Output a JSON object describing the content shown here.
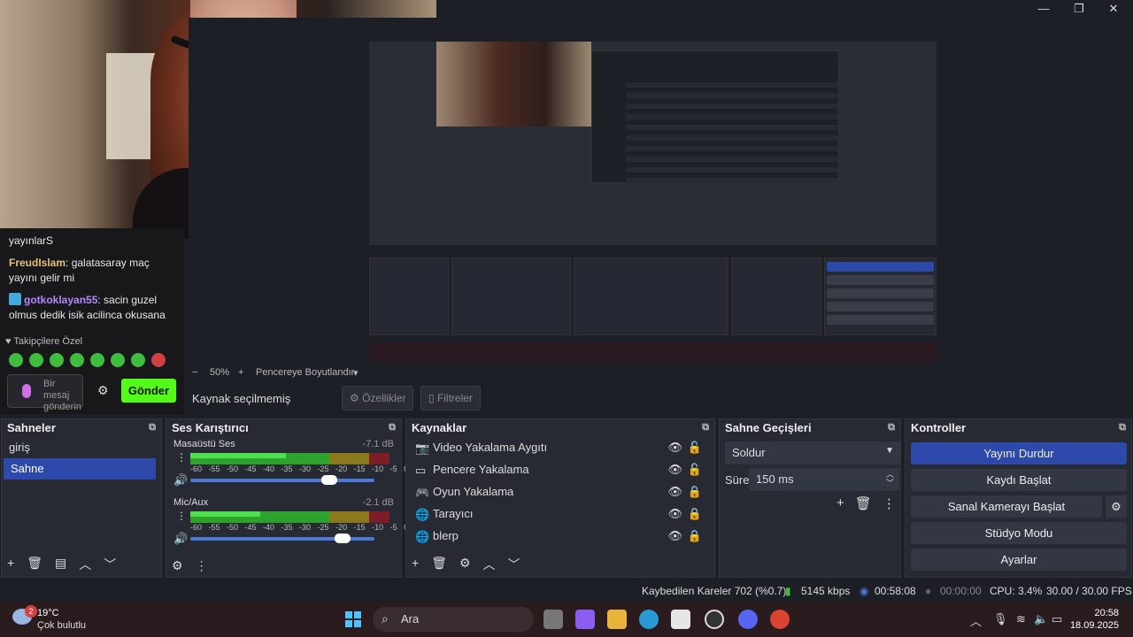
{
  "window": {
    "minimize": "—",
    "maximize": "❐",
    "close": "✕"
  },
  "chat": {
    "msg0_tail": "yayınlarS",
    "msg1_user": "FreudIslam",
    "msg1_text": ": galatasaray maç yayını gelir mi",
    "msg2_user": "gotkoklayan55",
    "msg2_text": ": sacin guzel olmus dedik isik acilinca okusana",
    "follow_label": "Takipçilere Özel",
    "input_placeholder": "Bir mesaj gönderin",
    "send_label": "Gönder"
  },
  "zoom": {
    "minus": "−",
    "level": "50%",
    "plus": "+",
    "fit": "Pencereye Boyutlandır"
  },
  "source_toolbar": {
    "no_source": "Kaynak seçilmemiş",
    "properties": "Özellikler",
    "filters": "Filtreler"
  },
  "scenes": {
    "title": "Sahneler",
    "items": [
      "giriş",
      "Sahne"
    ]
  },
  "mixer": {
    "title": "Ses Karıştırıcı",
    "tracks": [
      {
        "name": "Masaüstü Ses",
        "db": "-7.1 dB",
        "level": 0.48,
        "volume": 0.78
      },
      {
        "name": "Mic/Aux",
        "db": "-2.1 dB",
        "level": 0.35,
        "volume": 0.86
      }
    ],
    "ticks": "-60 -55 -50 -45 -40 -35 -30 -25 -20 -15 -10 -5 0"
  },
  "sources": {
    "title": "Kaynaklar",
    "items": [
      {
        "name": "Video Yakalama Aygıtı",
        "icon": "camera-icon"
      },
      {
        "name": "Pencere Yakalama",
        "icon": "window-icon"
      },
      {
        "name": "Oyun Yakalama",
        "icon": "gamepad-icon"
      },
      {
        "name": "Tarayıcı",
        "icon": "globe-icon"
      },
      {
        "name": "blerp",
        "icon": "globe-icon"
      }
    ]
  },
  "transitions": {
    "title": "Sahne Geçişleri",
    "type": "Soldur",
    "duration_label": "Süre",
    "duration": "150 ms"
  },
  "controls": {
    "title": "Kontroller",
    "stop_stream": "Yayını Durdur",
    "start_record": "Kaydı Başlat",
    "virtual_cam": "Sanal Kamerayı Başlat",
    "studio_mode": "Stüdyo Modu",
    "settings": "Ayarlar"
  },
  "status": {
    "dropped": "Kaybedilen Kareler 702 (%0.7)",
    "bitrate": "5145 kbps",
    "stream_time": "00:58:08",
    "rec_time": "00:00:00",
    "cpu": "CPU: 3.4%",
    "fps": "30.00 / 30.00 FPS"
  },
  "taskbar": {
    "weather_temp": "19°C",
    "weather_desc": "Çok bulutlu",
    "weather_badge": "2",
    "search": "Ara",
    "time": "20:58",
    "date": "18.09.2025"
  },
  "colors": {
    "accent": "#2d4aaa",
    "kick_green": "#53fc18",
    "bg": "#1d1f27",
    "panel": "#272a33"
  }
}
